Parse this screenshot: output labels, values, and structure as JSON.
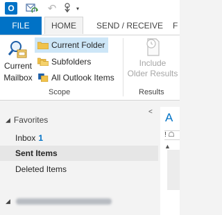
{
  "qat": {
    "app_icon_text": "O",
    "icons": [
      "outlook-app-icon",
      "send-receive-all-icon",
      "undo-icon",
      "touch-mode-icon",
      "customize-dropdown-icon"
    ]
  },
  "tabs": {
    "file": "FILE",
    "home": "HOME",
    "send_receive": "SEND / RECEIVE",
    "partial": "F"
  },
  "ribbon": {
    "current_mailbox_line1": "Current",
    "current_mailbox_line2": "Mailbox",
    "current_folder": "Current Folder",
    "subfolders": "Subfolders",
    "all_outlook_items": "All Outlook Items",
    "group_scope": "Scope",
    "include_line1": "Include",
    "include_line2": "Older Results",
    "group_results": "Results"
  },
  "nav": {
    "collapse_glyph": "<",
    "favorites": "Favorites",
    "items": [
      {
        "label": "Inbox",
        "count": "1"
      },
      {
        "label": "Sent Items"
      },
      {
        "label": "Deleted Items"
      }
    ]
  },
  "content": {
    "partial_title": "A",
    "header_glyphs": "! ☖",
    "sort_glyph": "▲"
  },
  "colors": {
    "accent": "#0072c6",
    "selected_tab_fill": "#cde6f7",
    "selected_item": "#e6e6e6"
  }
}
